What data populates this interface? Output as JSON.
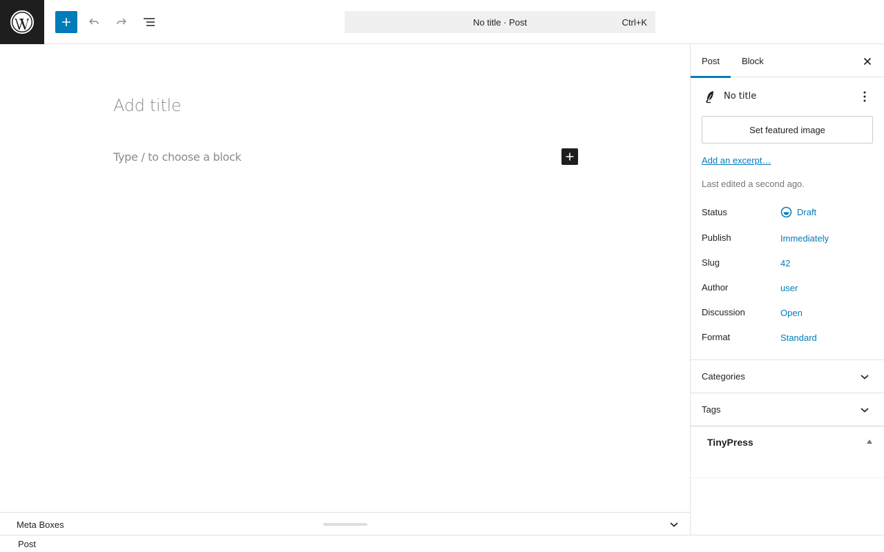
{
  "toolbar": {
    "command_bar_label": "No title · Post",
    "command_bar_shortcut": "Ctrl+K"
  },
  "editor": {
    "title_placeholder": "Add title",
    "block_placeholder": "Type / to choose a block"
  },
  "meta_boxes": {
    "label": "Meta Boxes"
  },
  "footer": {
    "breadcrumb": "Post"
  },
  "sidebar": {
    "tabs": [
      {
        "label": "Post",
        "active": true
      },
      {
        "label": "Block",
        "active": false
      }
    ],
    "post_card": {
      "title": "No title"
    },
    "featured_image_label": "Set featured image",
    "excerpt_link": "Add an excerpt…",
    "last_edited": "Last edited a second ago.",
    "rows": [
      {
        "label": "Status",
        "value": "Draft"
      },
      {
        "label": "Publish",
        "value": "Immediately"
      },
      {
        "label": "Slug",
        "value": "42"
      },
      {
        "label": "Author",
        "value": "user"
      },
      {
        "label": "Discussion",
        "value": "Open"
      },
      {
        "label": "Format",
        "value": "Standard"
      }
    ],
    "panels": [
      {
        "label": "Categories"
      },
      {
        "label": "Tags"
      }
    ],
    "metabox_title": "TinyPress"
  },
  "colors": {
    "accent": "#007cba",
    "dark": "#1e1e1e"
  }
}
